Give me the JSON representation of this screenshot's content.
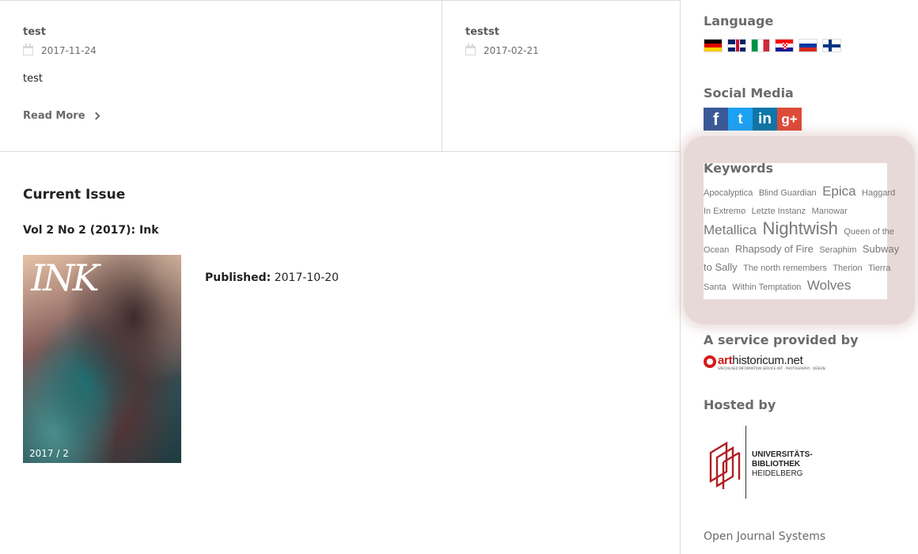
{
  "news": [
    {
      "title": "test",
      "date": "2017-11-24",
      "summary": "test",
      "read_more": "Read More"
    },
    {
      "title": "testst",
      "date": "2017-02-21"
    }
  ],
  "current_issue": {
    "heading": "Current Issue",
    "title": "Vol 2 No 2 (2017): Ink",
    "cover_logo": "INK",
    "cover_caption": "2017 / 2",
    "published_label": "Published:",
    "published_date": "2017-10-20"
  },
  "sidebar": {
    "language_heading": "Language",
    "languages": [
      "German",
      "English",
      "Italian",
      "Croatian",
      "Russian",
      "Finnish"
    ],
    "social_heading": "Social Media",
    "social": [
      {
        "name": "facebook",
        "glyph": "f"
      },
      {
        "name": "twitter",
        "glyph": "t"
      },
      {
        "name": "linkedin",
        "glyph": "in"
      },
      {
        "name": "google-plus",
        "glyph": "g+"
      }
    ],
    "keywords_heading": "Keywords",
    "keywords": [
      {
        "text": "Apocalyptica",
        "weight": 1
      },
      {
        "text": "Blind Guardian",
        "weight": 1
      },
      {
        "text": "Epica",
        "weight": 3
      },
      {
        "text": "Haggard",
        "weight": 1
      },
      {
        "text": "In Extremo",
        "weight": 1
      },
      {
        "text": "Letzte Instanz",
        "weight": 1
      },
      {
        "text": "Manowar",
        "weight": 1
      },
      {
        "text": "Metallica",
        "weight": 3
      },
      {
        "text": "Nightwish",
        "weight": 4
      },
      {
        "text": "Queen of the Ocean",
        "weight": 1
      },
      {
        "text": "Rhapsody of Fire",
        "weight": 2
      },
      {
        "text": "Seraphim",
        "weight": 1
      },
      {
        "text": "Subway to Sally",
        "weight": 2
      },
      {
        "text": "The north remembers",
        "weight": 1
      },
      {
        "text": "Therion",
        "weight": 1
      },
      {
        "text": "Tierra Santa",
        "weight": 1
      },
      {
        "text": "Within Temptation",
        "weight": 1
      },
      {
        "text": "Wolves",
        "weight": 3
      }
    ],
    "service_heading": "A service provided by",
    "service_logo": {
      "part1": "art",
      "part2": "historicum.net",
      "sub": "SPECIALISED INFORMATION SERVICE ART · PHOTOGRAPHY · DESIGN"
    },
    "hosted_heading": "Hosted by",
    "hosted_logo": {
      "line1": "UNIVERSITÄTS-",
      "line2": "BIBLIOTHEK",
      "line3": "HEIDELBERG"
    },
    "ojs_link": "Open Journal Systems"
  }
}
